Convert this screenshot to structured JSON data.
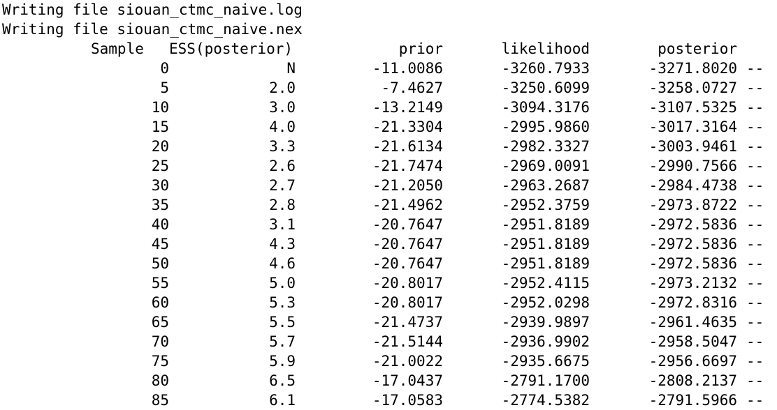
{
  "terminal": {
    "messages": [
      "Writing file siouan_ctmc_naive.log",
      "Writing file siouan_ctmc_naive.nex"
    ],
    "header": {
      "sample": "Sample",
      "ess": "ESS(posterior)",
      "prior": "prior",
      "likelihood": "likelihood",
      "posterior": "posterior"
    },
    "rows": [
      {
        "sample": "0",
        "ess": "N",
        "prior": "-11.0086",
        "likelihood": "-3260.7933",
        "posterior": "-3271.8020",
        "suffix": "--"
      },
      {
        "sample": "5",
        "ess": "2.0",
        "prior": "-7.4627",
        "likelihood": "-3250.6099",
        "posterior": "-3258.0727",
        "suffix": "--"
      },
      {
        "sample": "10",
        "ess": "3.0",
        "prior": "-13.2149",
        "likelihood": "-3094.3176",
        "posterior": "-3107.5325",
        "suffix": "--"
      },
      {
        "sample": "15",
        "ess": "4.0",
        "prior": "-21.3304",
        "likelihood": "-2995.9860",
        "posterior": "-3017.3164",
        "suffix": "--"
      },
      {
        "sample": "20",
        "ess": "3.3",
        "prior": "-21.6134",
        "likelihood": "-2982.3327",
        "posterior": "-3003.9461",
        "suffix": "--"
      },
      {
        "sample": "25",
        "ess": "2.6",
        "prior": "-21.7474",
        "likelihood": "-2969.0091",
        "posterior": "-2990.7566",
        "suffix": "--"
      },
      {
        "sample": "30",
        "ess": "2.7",
        "prior": "-21.2050",
        "likelihood": "-2963.2687",
        "posterior": "-2984.4738",
        "suffix": "--"
      },
      {
        "sample": "35",
        "ess": "2.8",
        "prior": "-21.4962",
        "likelihood": "-2952.3759",
        "posterior": "-2973.8722",
        "suffix": "--"
      },
      {
        "sample": "40",
        "ess": "3.1",
        "prior": "-20.7647",
        "likelihood": "-2951.8189",
        "posterior": "-2972.5836",
        "suffix": "--"
      },
      {
        "sample": "45",
        "ess": "4.3",
        "prior": "-20.7647",
        "likelihood": "-2951.8189",
        "posterior": "-2972.5836",
        "suffix": "--"
      },
      {
        "sample": "50",
        "ess": "4.6",
        "prior": "-20.7647",
        "likelihood": "-2951.8189",
        "posterior": "-2972.5836",
        "suffix": "--"
      },
      {
        "sample": "55",
        "ess": "5.0",
        "prior": "-20.8017",
        "likelihood": "-2952.4115",
        "posterior": "-2973.2132",
        "suffix": "--"
      },
      {
        "sample": "60",
        "ess": "5.3",
        "prior": "-20.8017",
        "likelihood": "-2952.0298",
        "posterior": "-2972.8316",
        "suffix": "--"
      },
      {
        "sample": "65",
        "ess": "5.5",
        "prior": "-21.4737",
        "likelihood": "-2939.9897",
        "posterior": "-2961.4635",
        "suffix": "--"
      },
      {
        "sample": "70",
        "ess": "5.7",
        "prior": "-21.5144",
        "likelihood": "-2936.9902",
        "posterior": "-2958.5047",
        "suffix": "--"
      },
      {
        "sample": "75",
        "ess": "5.9",
        "prior": "-21.0022",
        "likelihood": "-2935.6675",
        "posterior": "-2956.6697",
        "suffix": "--"
      },
      {
        "sample": "80",
        "ess": "6.5",
        "prior": "-17.0437",
        "likelihood": "-2791.1700",
        "posterior": "-2808.2137",
        "suffix": "--"
      },
      {
        "sample": "85",
        "ess": "6.1",
        "prior": "-17.0583",
        "likelihood": "-2774.5382",
        "posterior": "-2791.5966",
        "suffix": "--"
      }
    ],
    "colors": {
      "background": "#ffffff",
      "text": "#000000"
    }
  }
}
